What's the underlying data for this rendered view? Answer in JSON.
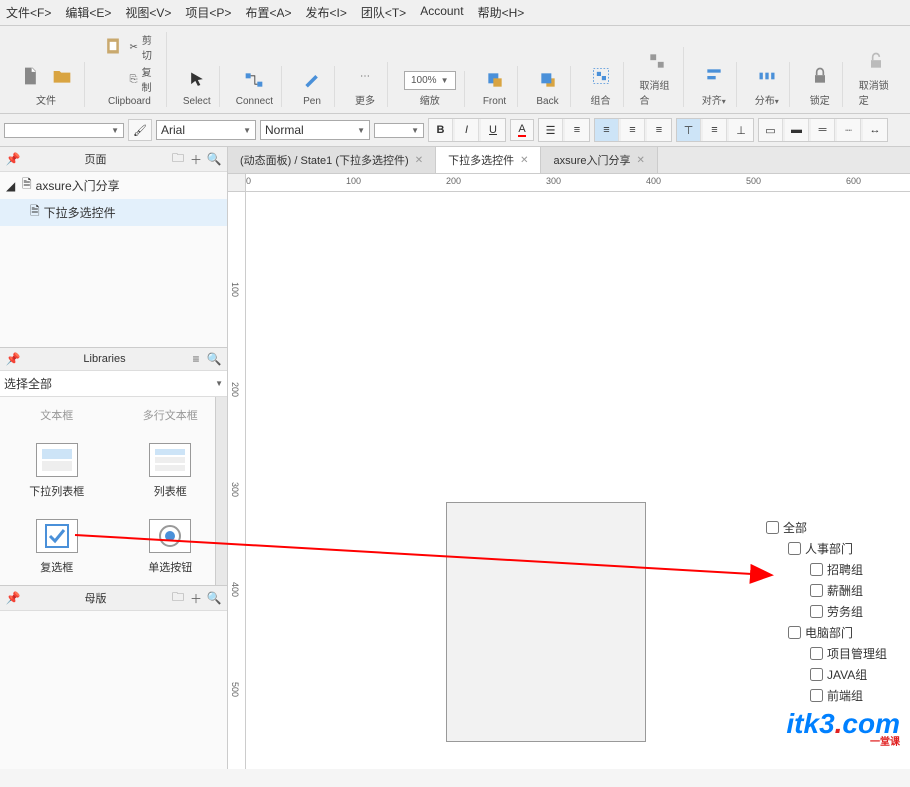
{
  "menu": {
    "file": "文件<F>",
    "edit": "编辑<E>",
    "view": "视图<V>",
    "project": "项目<P>",
    "layout": "布置<A>",
    "publish": "发布<I>",
    "team": "团队<T>",
    "account": "Account",
    "help": "帮助<H>"
  },
  "toolbar": {
    "file": "文件",
    "clipboard": "Clipboard",
    "cut": "剪切",
    "copy": "复制",
    "paste": "粘贴",
    "select": "Select",
    "connect": "Connect",
    "pen": "Pen",
    "more": "更多",
    "zoom": "缩放",
    "zoom_value": "100%",
    "front": "Front",
    "back": "Back",
    "group": "组合",
    "ungroup": "取消组合",
    "align": "对齐",
    "distribute": "分布",
    "lock": "锁定",
    "unlock": "取消锁定"
  },
  "format": {
    "font": "Arial",
    "style": "Normal",
    "size": ""
  },
  "panels": {
    "pages": "页面",
    "libraries": "Libraries",
    "masters": "母版"
  },
  "tree": {
    "root": "axsure入门分享",
    "child": "下拉多选控件"
  },
  "lib": {
    "select_all": "选择全部",
    "textbox": "文本框",
    "multitext": "多行文本框",
    "droplist": "下拉列表框",
    "listbox": "列表框",
    "checkbox": "复选框",
    "radio": "单选按钮"
  },
  "tabs": {
    "t1": "(动态面板) / State1 (下拉多选控件)",
    "t2": "下拉多选控件",
    "t3": "axsure入门分享"
  },
  "cbtree": {
    "all": "全部",
    "hr": "人事部门",
    "hr1": "招聘组",
    "hr2": "薪酬组",
    "hr3": "劳务组",
    "it": "电脑部门",
    "it1": "项目管理组",
    "it2": "JAVA组",
    "it3": "前端组"
  },
  "ruler_h": [
    "0",
    "100",
    "200",
    "300",
    "400",
    "500",
    "600"
  ],
  "ruler_v": [
    "100",
    "200",
    "300",
    "400",
    "500"
  ],
  "watermark": {
    "text_a": "itk3",
    "text_b": "com",
    "sub": "一堂课"
  }
}
